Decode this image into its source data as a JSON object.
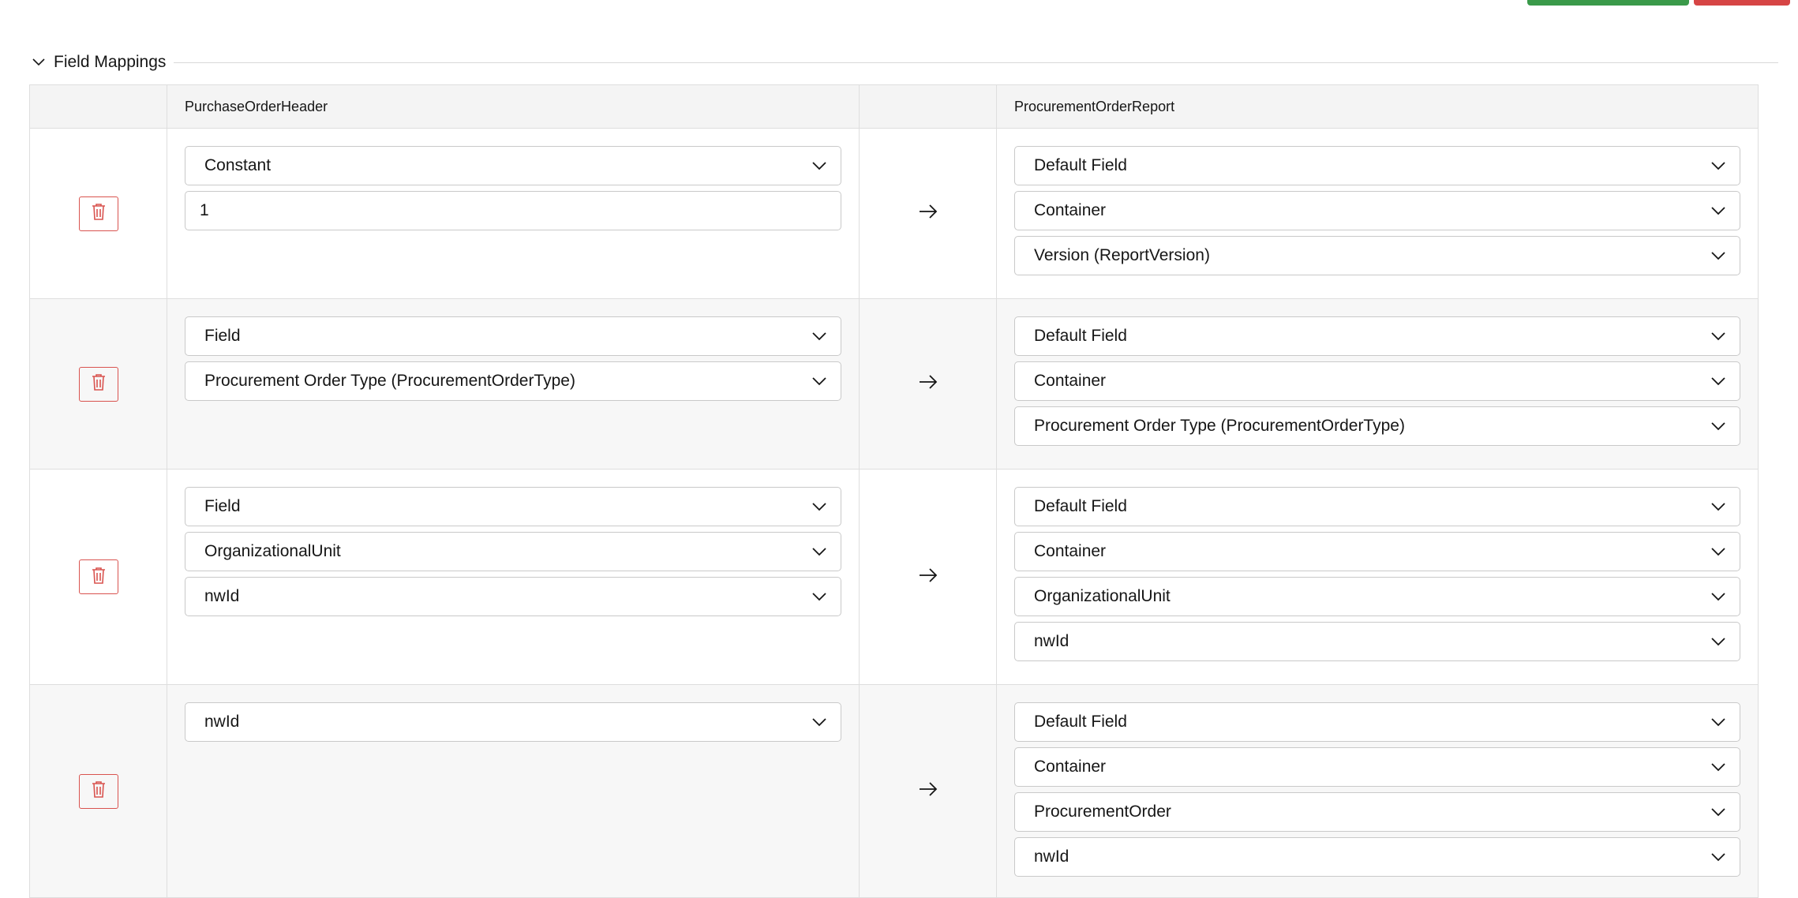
{
  "section": {
    "title": "Field Mappings"
  },
  "table": {
    "source_header": "PurchaseOrderHeader",
    "target_header": "ProcurementOrderReport",
    "rows": [
      {
        "source": [
          {
            "kind": "select",
            "value": "Constant"
          },
          {
            "kind": "text",
            "value": "1"
          }
        ],
        "target": [
          "Default Field",
          "Container",
          "Version (ReportVersion)"
        ]
      },
      {
        "source": [
          {
            "kind": "select",
            "value": "Field"
          },
          {
            "kind": "select",
            "value": "Procurement Order Type (ProcurementOrderType)"
          }
        ],
        "target": [
          "Default Field",
          "Container",
          "Procurement Order Type (ProcurementOrderType)"
        ]
      },
      {
        "source": [
          {
            "kind": "select",
            "value": "Field"
          },
          {
            "kind": "select",
            "value": "OrganizationalUnit"
          },
          {
            "kind": "select",
            "value": "nwId"
          }
        ],
        "target": [
          "Default Field",
          "Container",
          "OrganizationalUnit",
          "nwId"
        ]
      },
      {
        "source": [
          {
            "kind": "select",
            "value": "nwId"
          }
        ],
        "target": [
          "Default Field",
          "Container",
          "ProcurementOrder",
          "nwId"
        ]
      }
    ]
  },
  "colors": {
    "save_button": "#3a9a4a",
    "cancel_button": "#d64545",
    "delete_icon": "#d9534f"
  }
}
